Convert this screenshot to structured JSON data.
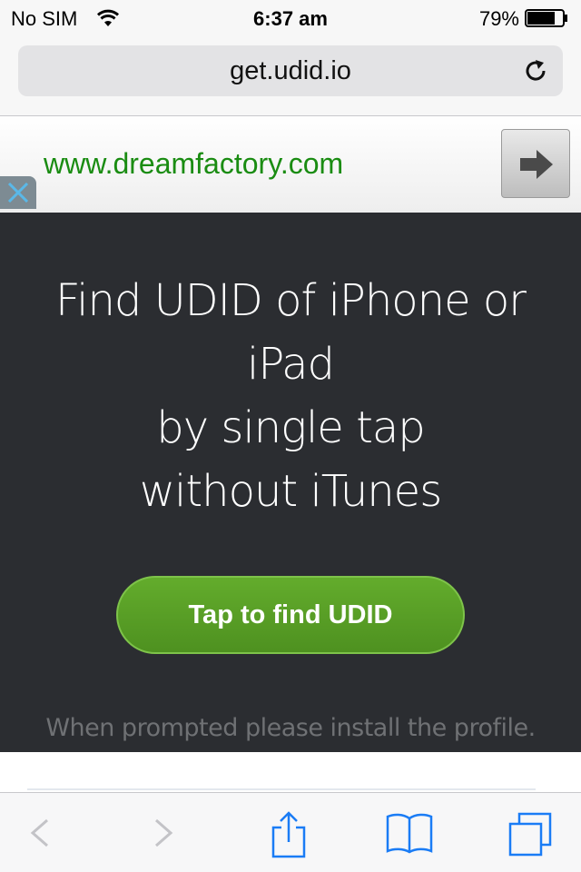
{
  "status_bar": {
    "carrier": "No SIM",
    "time": "6:37 am",
    "battery_percent": "79%",
    "battery_level": 0.79
  },
  "browser": {
    "url": "get.udid.io"
  },
  "ad": {
    "link_text": "www.dreamfactory.com",
    "link_color": "#1a8c12"
  },
  "hero": {
    "title_lines": [
      "Find UDID of iPhone or",
      "iPad",
      "by single tap",
      "without iTunes"
    ],
    "button_label": "Tap to find UDID",
    "note": "When prompted please install the profile."
  },
  "colors": {
    "hero_background": "#2b2d31",
    "button_green": "#5a9f26",
    "toolbar_accent": "#1a7cf5"
  },
  "toolbar": {
    "icons": [
      "back-icon",
      "forward-icon",
      "share-icon",
      "bookmarks-icon",
      "tabs-icon"
    ]
  }
}
